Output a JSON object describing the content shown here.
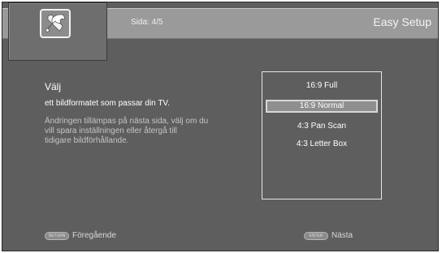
{
  "header": {
    "page_indicator": "Sida: 4/5",
    "title": "Easy Setup",
    "icon": "wrench-screwdriver-icon"
  },
  "content": {
    "heading": "Välj",
    "subheading": "ett bildformatet som passar din TV.",
    "description_lines": [
      "Ändringen tillämpas på nästa sida, välj om du",
      "vill spara inställningen eller återgå till",
      "tidigare bildförhållande."
    ]
  },
  "options": {
    "items": [
      "16:9 Full",
      "16:9 Normal",
      "4:3 Pan Scan",
      "4:3 Letter Box"
    ],
    "selected": "16:9 Normal"
  },
  "footer": {
    "back_key": "RETURN",
    "back_label": "Föregående",
    "next_key": "ENTER",
    "next_label": "Nästa"
  },
  "colors": {
    "background": "#5e5e5e",
    "header_band": "#9a9a9a",
    "selection": "#8f8f8f"
  }
}
